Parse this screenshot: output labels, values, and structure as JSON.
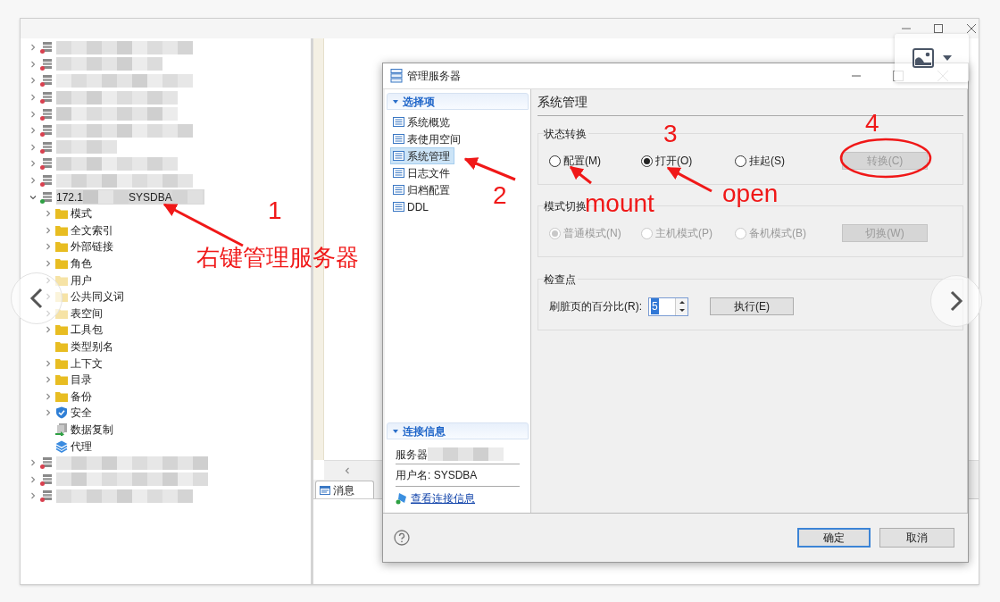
{
  "tree": {
    "items": [
      {
        "kind": "redacted",
        "color": "#d9404f",
        "expanded": false
      },
      {
        "kind": "redacted",
        "color": "#d9404f",
        "expanded": false
      },
      {
        "kind": "redacted",
        "color": "#d9404f",
        "expanded": false
      },
      {
        "kind": "redacted",
        "color": "#d9404f",
        "expanded": false
      },
      {
        "kind": "redacted",
        "color": "#d9404f",
        "expanded": false
      },
      {
        "kind": "redacted",
        "color": "#d9404f",
        "expanded": false
      },
      {
        "kind": "redacted",
        "color": "#d9404f",
        "expanded": false
      },
      {
        "kind": "redacted",
        "color": "#d9404f",
        "expanded": false
      },
      {
        "kind": "redacted",
        "color": "#d9404f",
        "expanded": false
      },
      {
        "kind": "server",
        "label": "172.1",
        "user": "SYSDBA",
        "color": "#2ea043",
        "expanded": true,
        "selected": true,
        "children": [
          {
            "label": "模式",
            "kind": "folder",
            "has_children": true
          },
          {
            "label": "全文索引",
            "kind": "folder",
            "has_children": true
          },
          {
            "label": "外部链接",
            "kind": "folder",
            "has_children": true
          },
          {
            "label": "角色",
            "kind": "folder",
            "has_children": true
          },
          {
            "label": "用户",
            "kind": "folder_pale",
            "has_children": true
          },
          {
            "label": "公共同义词",
            "kind": "folder_pale",
            "has_children": true
          },
          {
            "label": "表空间",
            "kind": "folder_pale",
            "has_children": true
          },
          {
            "label": "工具包",
            "kind": "folder",
            "has_children": true
          },
          {
            "label": "类型别名",
            "kind": "folder",
            "has_children": false
          },
          {
            "label": "上下文",
            "kind": "folder",
            "has_children": true
          },
          {
            "label": "目录",
            "kind": "folder",
            "has_children": true
          },
          {
            "label": "备份",
            "kind": "folder",
            "has_children": true
          },
          {
            "label": "安全",
            "kind": "shield",
            "has_children": true
          },
          {
            "label": "数据复制",
            "kind": "replication",
            "has_children": false
          },
          {
            "label": "代理",
            "kind": "layers",
            "has_children": false
          }
        ]
      },
      {
        "kind": "redacted",
        "color": "#d9404f",
        "expanded": false
      },
      {
        "kind": "redacted",
        "color": "#d9404f",
        "expanded": false
      },
      {
        "kind": "redacted",
        "color": "#d9404f",
        "expanded": false
      }
    ]
  },
  "editor": {
    "tab": "消息"
  },
  "dialog": {
    "title": "管理服务器",
    "nav": {
      "header": "选择项",
      "items": [
        {
          "label": "系统概览",
          "selected": false
        },
        {
          "label": "表使用空间",
          "selected": false
        },
        {
          "label": "系统管理",
          "selected": true
        },
        {
          "label": "日志文件",
          "selected": false
        },
        {
          "label": "归档配置",
          "selected": false
        },
        {
          "label": "DDL",
          "selected": false
        }
      ]
    },
    "connection": {
      "header": "连接信息",
      "server_label": "服务器",
      "user": "用户名: SYSDBA",
      "link": "查看连接信息"
    },
    "panel": {
      "title": "系统管理",
      "groups": [
        {
          "kind": "radio_group",
          "title": "状态转换",
          "radios": [
            {
              "label": "配置(M)",
              "selected": false,
              "disabled": false
            },
            {
              "label": "打开(O)",
              "selected": true,
              "disabled": false
            },
            {
              "label": "挂起(S)",
              "selected": false,
              "disabled": false
            }
          ],
          "button": {
            "label": "转换(C)",
            "disabled": true
          }
        },
        {
          "kind": "radio_group",
          "title": "模式切换",
          "radios": [
            {
              "label": "普通模式(N)",
              "selected": true,
              "disabled": true
            },
            {
              "label": "主机模式(P)",
              "selected": false,
              "disabled": true
            },
            {
              "label": "备机模式(B)",
              "selected": false,
              "disabled": true
            }
          ],
          "button": {
            "label": "切换(W)",
            "disabled": true
          }
        },
        {
          "kind": "checkpoint",
          "title": "检查点",
          "field_label": "刷脏页的百分比(R):",
          "spinner_value": "5",
          "value_selected": true,
          "button": {
            "label": "执行(E)",
            "disabled": false
          }
        }
      ]
    },
    "buttons": [
      {
        "label": "确定",
        "default": true
      },
      {
        "label": "取消",
        "default": false
      }
    ]
  },
  "annotations": [
    {
      "text": "1"
    },
    {
      "text": "右键管理服务器"
    },
    {
      "text": "2"
    },
    {
      "text": "3"
    },
    {
      "text": "mount"
    },
    {
      "text": "open"
    },
    {
      "text": "4"
    }
  ]
}
